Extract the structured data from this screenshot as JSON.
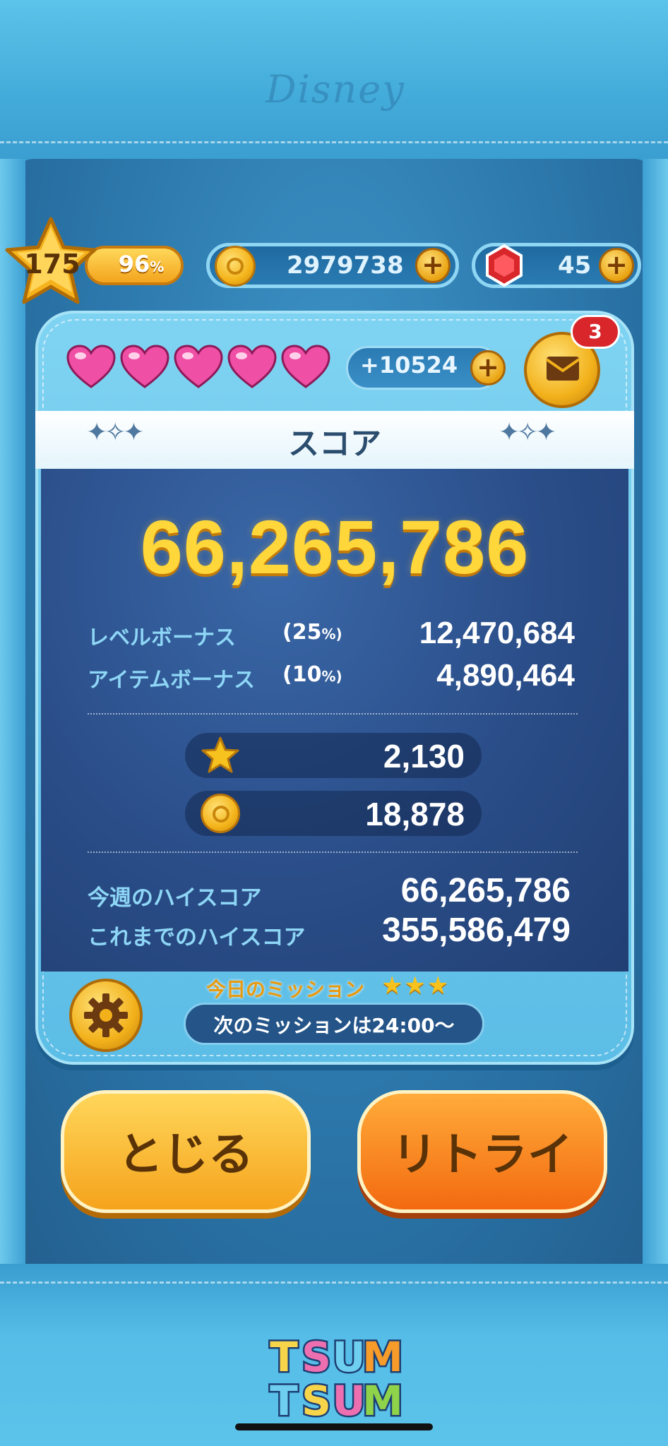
{
  "brand": {
    "disney_logo": "Disney",
    "game_logo_lines": [
      "TSUM",
      "TSUM"
    ]
  },
  "status": {
    "level": "175",
    "exp_percent": "96",
    "exp_unit": "%",
    "coins": "2979738",
    "gems": "45",
    "coin_plus": "+",
    "gem_plus": "+"
  },
  "hearts": {
    "count": 5,
    "timer": "+10524",
    "plus": "+"
  },
  "mail": {
    "badge": "3"
  },
  "score": {
    "title": "スコア",
    "total": "66,265,786",
    "level_bonus": {
      "label": "レベルボーナス",
      "pct": "(25",
      "pct_unit": "%)",
      "value": "12,470,684"
    },
    "item_bonus": {
      "label": "アイテムボーナス",
      "pct": "(10",
      "pct_unit": "%)",
      "value": "4,890,464"
    },
    "exp_gained": "2,130",
    "coins_gained": "18,878",
    "weekly_high_label": "今週のハイスコア",
    "weekly_high": "66,265,786",
    "all_time_high_label": "これまでのハイスコア",
    "all_time_high": "355,586,479"
  },
  "mission": {
    "title": "今日のミッション",
    "stars": "★★★",
    "next": "次のミッションは24:00〜"
  },
  "buttons": {
    "close": "とじる",
    "retry": "リトライ"
  },
  "colors": {
    "accent_gold": "#ffd73a",
    "panel_blue": "#2a4d88",
    "retry_orange": "#f36a10"
  }
}
